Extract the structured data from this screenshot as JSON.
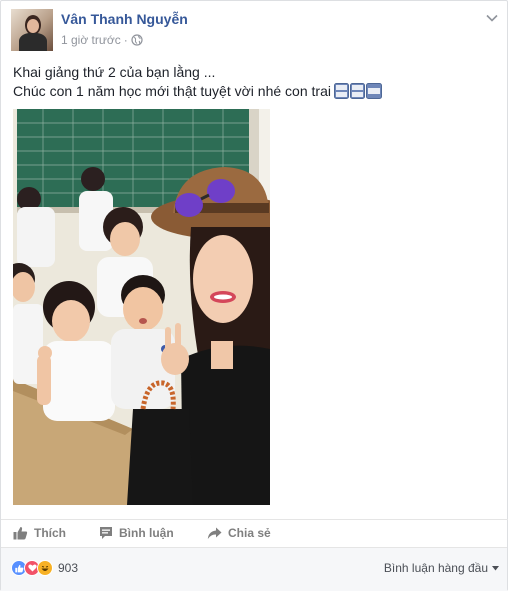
{
  "post": {
    "author": "Vân Thanh Nguyễn",
    "timestamp": "1 giờ trước",
    "separator": "·",
    "privacy_icon": "globe-icon",
    "menu_icon": "chevron-down-icon",
    "text_line1": "Khai giảng thứ 2 của bạn lằng ...",
    "text_line2": "Chúc con 1 năm học mới thật tuyệt vời nhé con trai",
    "text_emoji": "abcd-emoji",
    "photo_alt": "classroom selfie photo"
  },
  "actions": {
    "like_label": "Thích",
    "comment_label": "Bình luận",
    "share_label": "Chia sẻ"
  },
  "reactions": {
    "icons": [
      "like-reaction",
      "love-reaction",
      "haha-reaction"
    ],
    "count": "903",
    "sort_label": "Bình luận hàng đầu"
  },
  "colors": {
    "author": "#365899",
    "meta": "#90949c",
    "action": "#7f7f7f",
    "like": "#5890ff",
    "love": "#f25268",
    "haha": "#f7b125"
  }
}
